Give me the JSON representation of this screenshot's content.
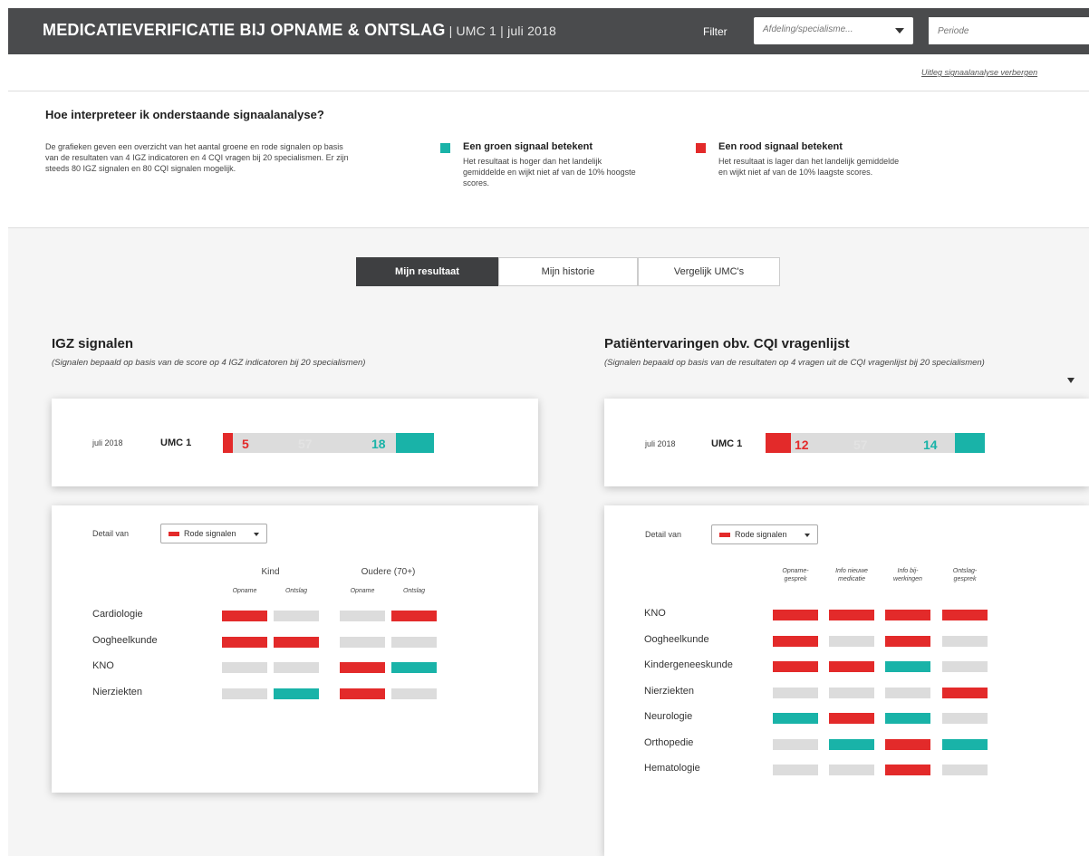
{
  "header": {
    "title": "MEDICATIEVERIFICATIE  BIJ OPNAME & ONTSLAG",
    "subtitle": "| UMC 1 | juli 2018",
    "filter_label": "Filter",
    "department_select": "Afdeling/specialisme...",
    "period_placeholder": "Periode"
  },
  "toggle_link": "Uitleg signaalanalyse verbergen",
  "explanation": {
    "title": "Hoe interpreteer ik onderstaande signaalanalyse?",
    "text": "De grafieken geven een overzicht van het aantal groene en rode signalen op basis van de resultaten van 4 IGZ indicatoren  en 4 CQI vragen bij 20 specialismen. Er zijn steeds 80 IGZ signalen en 80 CQI signalen mogelijk.",
    "green": {
      "title": "Een groen signaal betekent",
      "text": "Het resultaat is hoger dan het landelijk gemiddelde en wijkt niet af van de 10% hoogste scores."
    },
    "red": {
      "title": "Een rood signaal betekent",
      "text": "Het resultaat is lager dan het landelijk gemiddelde en wijkt niet af van de 10% laagste scores."
    }
  },
  "tabs": [
    "Mijn resultaat",
    "Mijn historie",
    "Vergelijk UMC's"
  ],
  "colors": {
    "red": "#e32a2a",
    "green": "#19b3a8",
    "grey": "#dcdcdc",
    "dark": "#4a4b4d"
  },
  "igz": {
    "title": "IGZ signalen",
    "subtitle": "(Signalen bepaald op basis van de score op 4 IGZ indicatoren bij 20 specialismen)",
    "summary": {
      "date": "juli 2018",
      "umc": "UMC 1",
      "red": 5,
      "grey": 57,
      "green": 18
    },
    "detail_label": "Detail van",
    "dropdown": "Rode signalen",
    "group_headers": [
      "Kind",
      "Oudere (70+)"
    ],
    "column_headers": [
      "Opname",
      "Ontslag",
      "Opname",
      "Ontslag"
    ],
    "rows": [
      {
        "label": "Cardiologie",
        "cells": [
          "red",
          "grey",
          "grey",
          "red"
        ]
      },
      {
        "label": "Oogheelkunde",
        "cells": [
          "red",
          "red",
          "grey",
          "grey"
        ]
      },
      {
        "label": "KNO",
        "cells": [
          "grey",
          "grey",
          "red",
          "green"
        ]
      },
      {
        "label": "Nierziekten",
        "cells": [
          "grey",
          "green",
          "red",
          "grey"
        ]
      }
    ]
  },
  "cqi": {
    "title": "Patiëntervaringen obv. CQI vragenlijst",
    "subtitle": "(Signalen bepaald op basis van de resultaten op 4 vragen uit de CQI vragenlijst  bij 20 specialismen)",
    "summary": {
      "date": "juli 2018",
      "umc": "UMC 1",
      "red": 12,
      "grey": 57,
      "green": 14
    },
    "detail_label": "Detail van",
    "dropdown": "Rode signalen",
    "column_headers": [
      "Opname-\ngesprek",
      "Info nieuwe\nmedicatie",
      "Info bij-\nwerkingen",
      "Ontslag-\ngesprek"
    ],
    "rows": [
      {
        "label": "KNO",
        "cells": [
          "red",
          "red",
          "red",
          "red"
        ]
      },
      {
        "label": "Oogheelkunde",
        "cells": [
          "red",
          "grey",
          "red",
          "grey"
        ]
      },
      {
        "label": "Kindergeneeskunde",
        "cells": [
          "red",
          "red",
          "green",
          "grey"
        ]
      },
      {
        "label": "Nierziekten",
        "cells": [
          "grey",
          "grey",
          "grey",
          "red"
        ]
      },
      {
        "label": "Neurologie",
        "cells": [
          "green",
          "red",
          "green",
          "grey"
        ]
      },
      {
        "label": "Orthopedie",
        "cells": [
          "grey",
          "green",
          "red",
          "green"
        ]
      },
      {
        "label": "Hematologie",
        "cells": [
          "grey",
          "grey",
          "red",
          "grey"
        ]
      }
    ]
  }
}
